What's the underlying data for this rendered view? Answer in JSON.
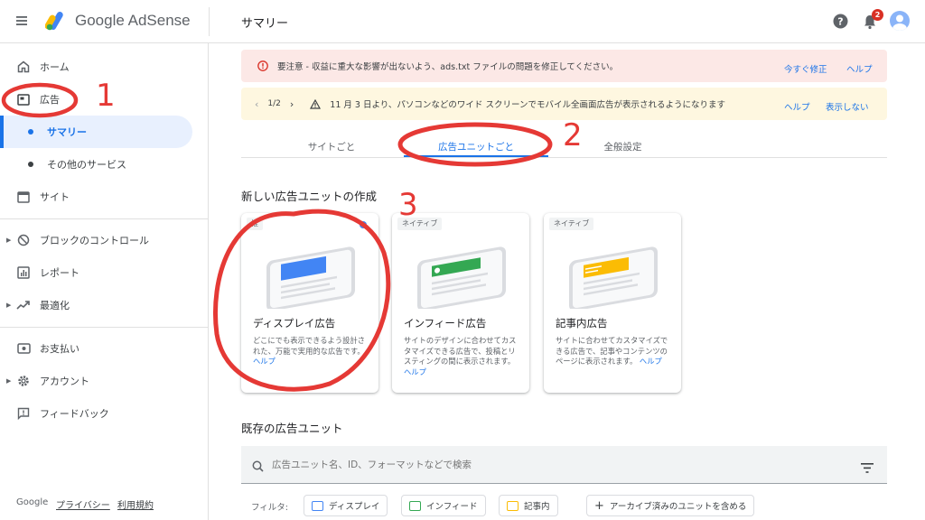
{
  "header": {
    "app_name": "Google AdSense",
    "page_title": "サマリー",
    "notification_count": "2"
  },
  "sidebar": {
    "items": [
      {
        "label": "ホーム",
        "icon": "home-icon"
      },
      {
        "label": "広告",
        "icon": "ads-icon"
      },
      {
        "label": "サマリー"
      },
      {
        "label": "その他のサービス"
      },
      {
        "label": "サイト",
        "icon": "sites-icon"
      },
      {
        "label": "ブロックのコントロール",
        "icon": "block-icon"
      },
      {
        "label": "レポート",
        "icon": "report-icon"
      },
      {
        "label": "最適化",
        "icon": "optimize-icon"
      },
      {
        "label": "お支払い",
        "icon": "payment-icon"
      },
      {
        "label": "アカウント",
        "icon": "gear-icon"
      },
      {
        "label": "フィードバック",
        "icon": "feedback-icon"
      }
    ],
    "footer": {
      "brand": "Google",
      "privacy": "プライバシー",
      "terms": "利用規約"
    }
  },
  "alerts": {
    "warning": {
      "text": "要注意 - 収益に重大な影響が出ないよう、ads.txt ファイルの問題を修正してください。",
      "action_fix": "今すぐ修正",
      "action_help": "ヘルプ"
    },
    "notice": {
      "pager": "1/2",
      "text": "11 月 3 日より、パソコンなどのワイド スクリーンでモバイル全画面広告が表示されるようになります",
      "action_help": "ヘルプ",
      "action_hide": "表示しない"
    }
  },
  "tabs": [
    "サイトごと",
    "広告ユニットごと",
    "全般設定"
  ],
  "create_section": {
    "title": "新しい広告ユニットの作成",
    "cards": [
      {
        "chip": "推",
        "title": "ディスプレイ広告",
        "desc": "どこにでも表示できるよう設計された、万能で実用的な広告です。",
        "help": "ヘルプ",
        "color": "#4285f4"
      },
      {
        "chip": "ネイティブ",
        "title": "インフィード広告",
        "desc": "サイトのデザインに合わせてカスタマイズできる広告で、投稿とリスティングの間に表示されます。",
        "help": "ヘルプ",
        "color": "#34a853"
      },
      {
        "chip": "ネイティブ",
        "title": "記事内広告",
        "desc": "サイトに合わせてカスタマイズできる広告で、記事やコンテンツのページに表示されます。",
        "help": "ヘルプ",
        "color": "#fbbc04"
      }
    ]
  },
  "existing_section": {
    "title": "既存の広告ユニット",
    "search_placeholder": "広告ユニット名、ID、フォーマットなどで検索",
    "filter_label": "フィルタ:",
    "filters": [
      {
        "label": "ディスプレイ",
        "color": "#4285f4"
      },
      {
        "label": "インフィード",
        "color": "#34a853"
      },
      {
        "label": "記事内",
        "color": "#fbbc04"
      }
    ],
    "archive_filter": "アーカイブ済みのユニットを含める"
  },
  "annotations": [
    "1",
    "2",
    "3"
  ],
  "colors": {
    "accent": "#1a73e8",
    "warning_bg": "#fce8e6",
    "notice_bg": "#fef7e0",
    "annotation": "#e53935"
  }
}
